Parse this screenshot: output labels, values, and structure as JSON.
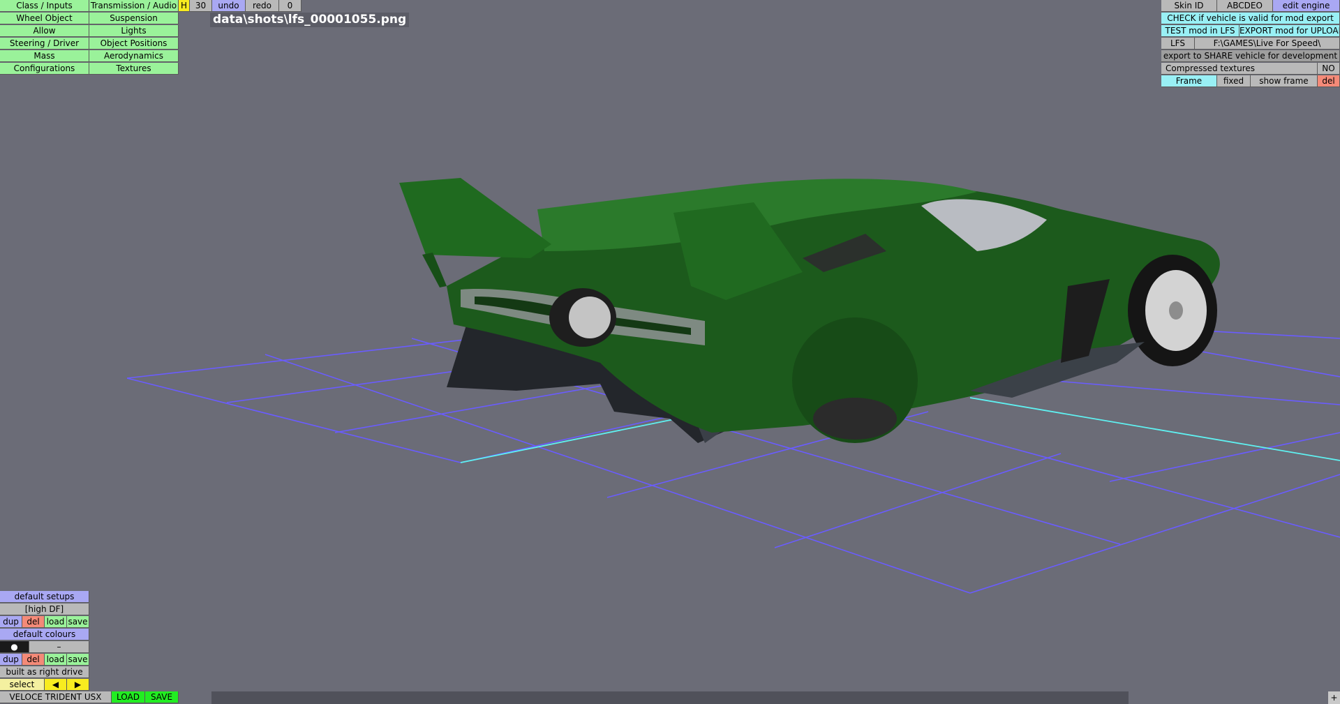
{
  "left_menu": {
    "class_inputs": "Class / Inputs",
    "transmission_audio": "Transmission / Audio",
    "wheel_object": "Wheel Object",
    "suspension": "Suspension",
    "allow": "Allow",
    "lights": "Lights",
    "steering_driver": "Steering / Driver",
    "object_positions": "Object Positions",
    "mass": "Mass",
    "aerodynamics": "Aerodynamics",
    "configurations": "Configurations",
    "textures": "Textures"
  },
  "history": {
    "h_label": "H",
    "undo_count": "30",
    "undo": "undo",
    "redo": "redo",
    "redo_count": "0"
  },
  "screenshot_path": "data\\shots\\lfs_00001055.png",
  "right_panel": {
    "skin_id_label": "Skin ID",
    "skin_id_value": "ABCDEO",
    "edit_engine": "edit engine",
    "check_valid": "CHECK if vehicle is valid for mod export",
    "test_mod": "TEST mod in LFS",
    "export_upload": "EXPORT mod for UPLOAD",
    "lfs_label": "LFS",
    "lfs_path": "F:\\GAMES\\Live For Speed\\",
    "export_share": "export to SHARE vehicle for development",
    "compressed_textures": "Compressed textures",
    "compressed_value": "NO",
    "frame": "Frame",
    "fixed": "fixed",
    "show_frame": "show frame",
    "del": "del"
  },
  "bottom_left": {
    "default_setups": "default setups",
    "setup_name": "[high DF]",
    "dup": "dup",
    "del": "del",
    "load": "load",
    "save": "save",
    "default_colours": "default colours",
    "colour_dot": "●",
    "colour_dash": "–",
    "built_right_drive": "built as right drive",
    "select": "select",
    "prev_arrow": "◀",
    "next_arrow": "▶",
    "vehicle_name": "VELOCE TRIDENT USX",
    "load_caps": "LOAD",
    "save_caps": "SAVE"
  },
  "scroll_corner": "+",
  "colors": {
    "background": "#6b6c77",
    "green_button": "#9af29a",
    "blue_button": "#a9a8f3",
    "cyan_button": "#99f0f5",
    "red_button": "#f48a78",
    "grid_line": "#6a5cff",
    "grid_axis": "#5ff2f2",
    "car_body": "#1c5a1c"
  },
  "icons": {
    "prev": "left-arrow-icon",
    "next": "right-arrow-icon",
    "colour_swatch": "colour-dot-icon"
  }
}
